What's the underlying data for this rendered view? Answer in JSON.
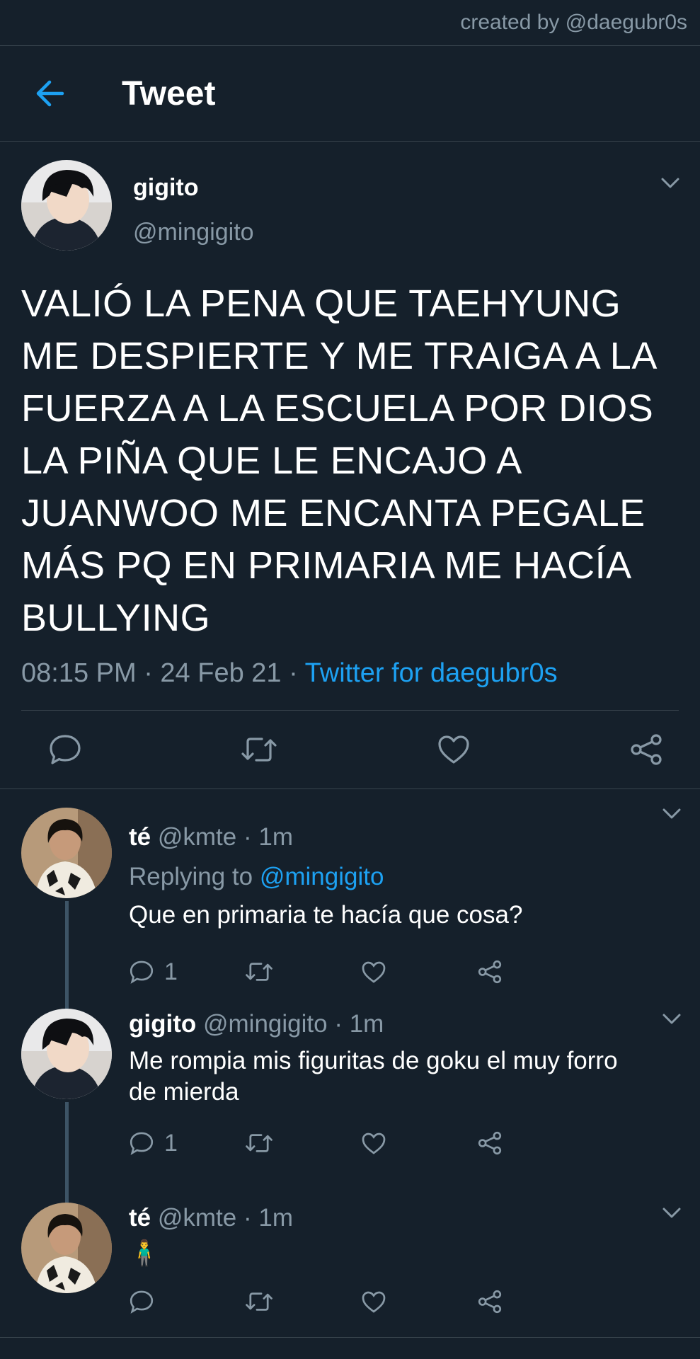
{
  "watermark": "created by @daegubr0s",
  "header": {
    "title": "Tweet",
    "back_icon": "arrow-left-icon"
  },
  "main_tweet": {
    "author_name": "gigito",
    "author_handle": "@mingigito",
    "text": "VALIÓ LA PENA QUE TAEHYUNG ME DESPIERTE Y ME TRAIGA A LA FUERZA A LA ESCUELA POR DIOS LA PIÑA QUE LE ENCAJO A JUANWOO ME ENCANTA PEGALE MÁS PQ EN PRIMARIA ME HACÍA BULLYING",
    "time": "08:15 PM · 24 Feb 21 · ",
    "source": "Twitter for daegubr0s",
    "actions": [
      "reply-icon",
      "retweet-icon",
      "like-icon",
      "share-icon"
    ]
  },
  "replies": [
    {
      "name": "té",
      "handle": "@kmte",
      "time": "· 1m",
      "replying_prefix": "Replying to ",
      "replying_to": "@mingigito",
      "text": "Que en primaria te hacía que cosa?",
      "reply_count": "1"
    },
    {
      "name": "gigito",
      "handle": "@mingigito",
      "time": "· 1m",
      "text": "Me rompia mis figuritas de goku el muy forro de mierda",
      "reply_count": "1"
    },
    {
      "name": "té",
      "handle": "@kmte",
      "time": "· 1m",
      "text": "🧍‍♂️",
      "reply_count": ""
    }
  ],
  "colors": {
    "background": "#15202b",
    "muted": "#8899a6",
    "accent": "#1da1f2",
    "divider": "#38444d"
  }
}
